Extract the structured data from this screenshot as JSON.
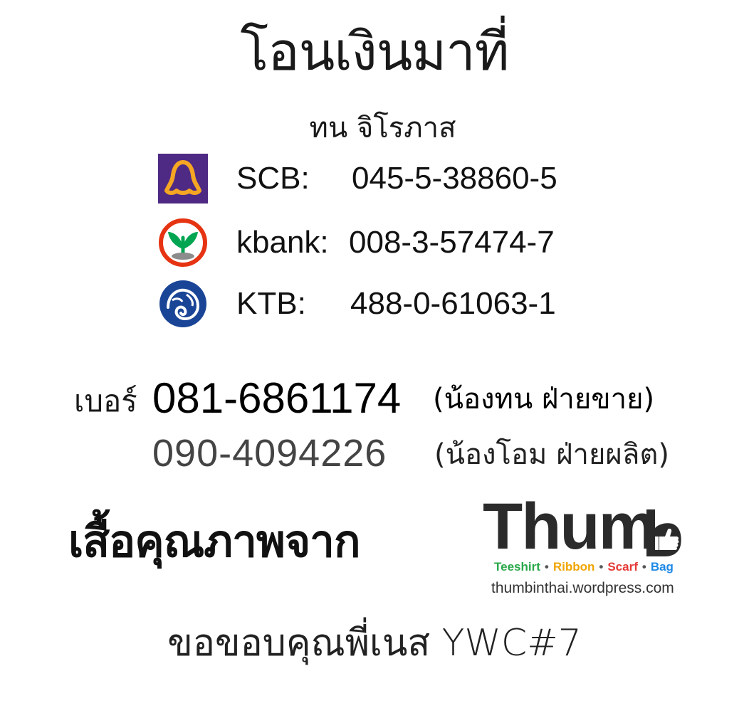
{
  "header": {
    "title": "โอนเงินมาที่",
    "account_name": "ทน จิโรภาส"
  },
  "banks": [
    {
      "label": "SCB:",
      "number": "045-5-38860-5",
      "logo_icon": "scb-logo",
      "color": "#4e2a84",
      "accent": "#f5a623"
    },
    {
      "label": "kbank:",
      "number": "008-3-57474-7",
      "logo_icon": "kbank-logo",
      "color": "#e63312",
      "accent": "#00a551"
    },
    {
      "label": "KTB:",
      "number": "488-0-61063-1",
      "logo_icon": "ktb-logo",
      "color": "#1a4597",
      "accent": "#ffffff"
    }
  ],
  "contact": {
    "prefix": "เบอร์",
    "main_phone": "081-6861174",
    "main_note": "(น้องทน ฝ่ายขาย)",
    "alt_phone": "090-4094226",
    "alt_note": "(น้องโอม ฝ่ายผลิต)"
  },
  "promo": {
    "slogan": "เสื้อคุณภาพจาก",
    "brand": "Thum",
    "brand_icon": "thumbs-up-b-icon",
    "tags": [
      {
        "text": "Teeshirt",
        "color": "#2aa84a"
      },
      {
        "text": "Ribbon",
        "color": "#f0a500"
      },
      {
        "text": "Scarf",
        "color": "#e53935"
      },
      {
        "text": "Bag",
        "color": "#1e88e5"
      }
    ],
    "tag_separator": "•",
    "url": "thumbinthai.wordpress.com"
  },
  "footer": {
    "thanks": "ขอขอบคุณพี่เนส YWC#7"
  }
}
